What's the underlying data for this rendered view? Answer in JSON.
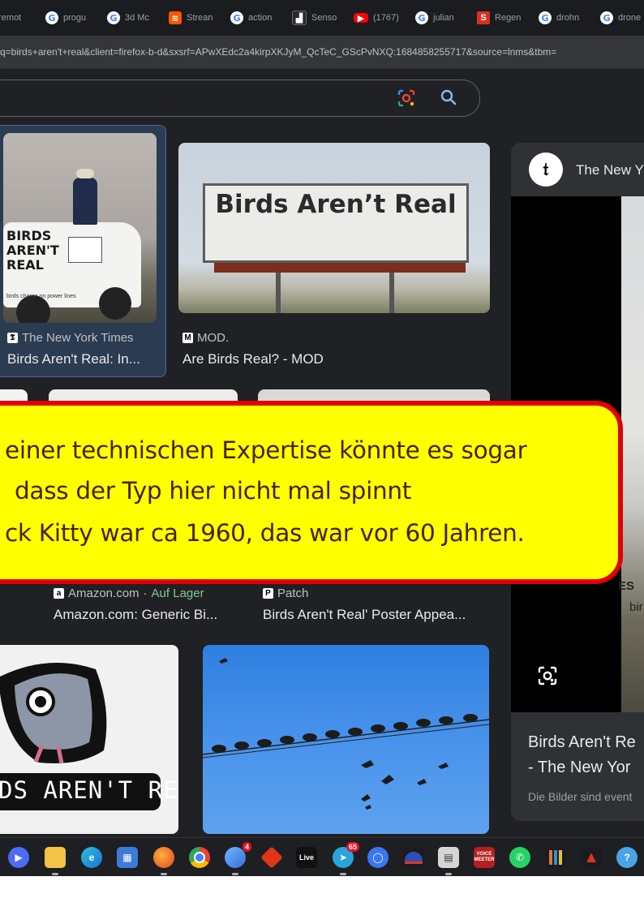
{
  "browser": {
    "tabs": [
      {
        "label": "remot",
        "icon": "google-icon"
      },
      {
        "label": "progu",
        "icon": "google-icon"
      },
      {
        "label": "3d Mc",
        "icon": "google-icon"
      },
      {
        "label": "Strean",
        "icon": "soundcloud-icon"
      },
      {
        "label": "action",
        "icon": "google-icon"
      },
      {
        "label": "Senso",
        "icon": "sensor-app-icon"
      },
      {
        "label": "(1767)",
        "icon": "youtube-icon"
      },
      {
        "label": "julian",
        "icon": "google-icon"
      },
      {
        "label": "Regen",
        "icon": "s-app-icon"
      },
      {
        "label": "drohn",
        "icon": "google-icon"
      },
      {
        "label": "drone",
        "icon": "google-icon"
      }
    ],
    "url": "q=birds+aren't+real&client=firefox-b-d&sxsrf=APwXEdc2a4kirpXKJyM_QcTeC_GScPvNXQ:1684858255717&source=lnms&tbm="
  },
  "search": {
    "lens_icon": "google-lens-icon",
    "search_icon": "magnifier-icon"
  },
  "results": [
    {
      "source": "The New York Times",
      "source_icon": "nyt-icon",
      "title": "Birds Aren't Real: In...",
      "selected": true,
      "van_text": [
        "BIRDS",
        "AREN'T",
        "REAL"
      ],
      "van_caption": "birds charge on power lines"
    },
    {
      "source": "MOD.",
      "source_icon": "mod-icon",
      "title": "Are Birds Real? - MOD",
      "billboard_text": "Birds Aren’t Real"
    },
    {
      "source": "Amazon.com",
      "source_extra": "Auf Lager",
      "source_icon": "amazon-icon",
      "title": "Amazon.com: Generic Bi..."
    },
    {
      "source": "Patch",
      "source_icon": "patch-icon",
      "title": "Birds Aren't Real' Poster Appea..."
    }
  ],
  "sticker_text": "DS AREN'T REAL",
  "panel": {
    "source": "The New Y",
    "logo": "𝔱",
    "title_line1": "Birds Aren't Re",
    "title_line2": "- The New Yor",
    "note": "Die Bilder sind event",
    "photo_text": [
      "ES",
      "bir"
    ]
  },
  "overlay": {
    "lines": [
      "einer technischen Expertise könnte es sogar",
      "dass der Typ hier nicht mal spinnt",
      "ck Kitty war ca 1960, das war vor 60 Jahren."
    ],
    "background": "#ffff00",
    "border": "#e10000"
  },
  "taskbar": {
    "items": [
      {
        "icon": "zoom-icon"
      },
      {
        "icon": "file-explorer-icon"
      },
      {
        "icon": "edge-icon"
      },
      {
        "icon": "microsoft-store-icon"
      },
      {
        "icon": "firefox-icon"
      },
      {
        "icon": "chrome-icon"
      },
      {
        "icon": "messenger-icon",
        "badge": "4"
      },
      {
        "icon": "red-cube-icon"
      },
      {
        "icon": "live-icon",
        "label": "Live"
      },
      {
        "icon": "telegram-icon",
        "badge": "65"
      },
      {
        "icon": "signal-icon"
      },
      {
        "icon": "blue-dome-icon"
      },
      {
        "icon": "calculator-icon"
      },
      {
        "icon": "voicemeeter-icon",
        "label": "VOICE MEETER"
      },
      {
        "icon": "whatsapp-icon"
      },
      {
        "icon": "library-icon"
      },
      {
        "icon": "red-triangle-icon"
      },
      {
        "icon": "help-icon"
      }
    ]
  }
}
